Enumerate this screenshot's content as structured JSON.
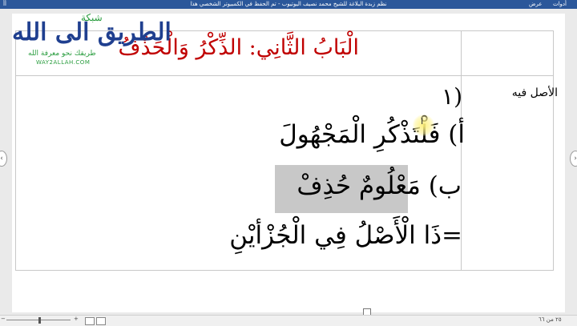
{
  "titlebar": {
    "doc_title": "نظم زبدة البلاغة للشيخ محمد نصيف اليوتيوب - تم الحفظ في الكمبيوتر الشخصي هذا",
    "view_tab": "عرض",
    "tools_tab": "أدوات",
    "left_label": "أأ"
  },
  "logo": {
    "top_word": "شبكة",
    "main_word": "الطريق الى الله",
    "subtitle": "طريقك نحو معرفة الله",
    "url": "WAY2ALLAH.COM"
  },
  "document": {
    "heading": "الْبَابُ الثَّانِي: الذِّكْرُ وَالْحَذْفُ",
    "side_label": "الأصل فيه",
    "number": "١)",
    "line_a": "أ) فَلْتَذْكُرِ الْمَجْهُولَ",
    "line_b": "ب) مَعْلُومٌ حُذِفْ",
    "line_c": "=ذَا الْأَصْلُ فِي الْجُزْأيْنِ"
  },
  "statusbar": {
    "page_count": "٢٥ من ٦٦",
    "zoom_minus": "−",
    "zoom_plus": "+"
  },
  "colors": {
    "titlebar": "#2b579a",
    "heading": "#c00000",
    "logo_blue": "#1f3f8f",
    "logo_green": "#2a9d3f",
    "highlight": "#c8c8c8"
  }
}
